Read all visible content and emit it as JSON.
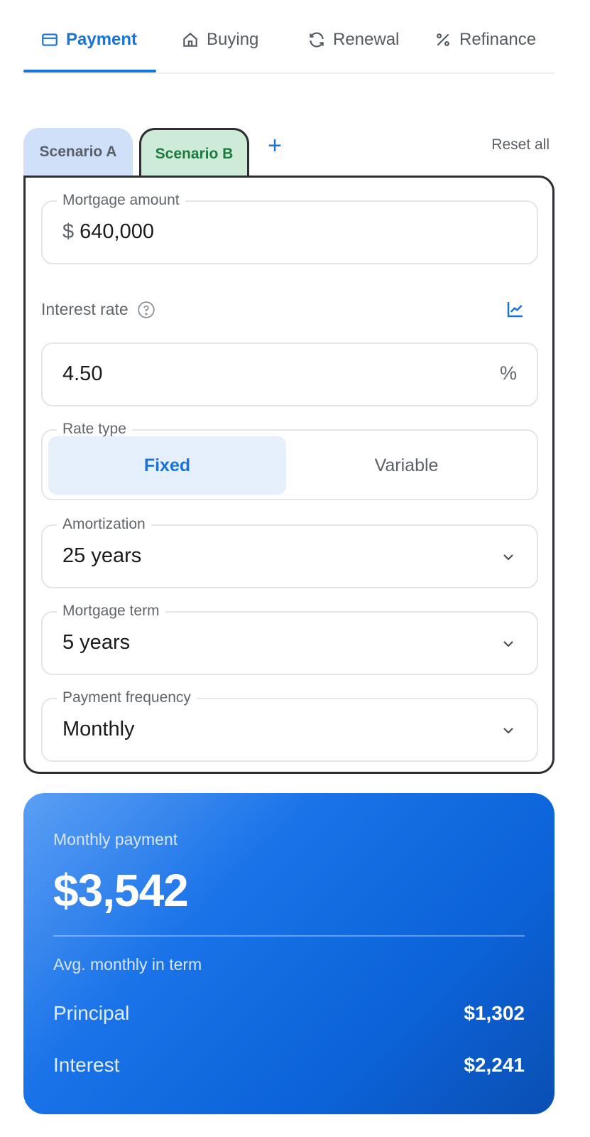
{
  "nav": {
    "tabs": [
      {
        "label": "Payment",
        "icon": "card-icon",
        "active": true
      },
      {
        "label": "Buying",
        "icon": "home-icon"
      },
      {
        "label": "Renewal",
        "icon": "refresh-icon"
      },
      {
        "label": "Refinance",
        "icon": "percent-icon"
      }
    ],
    "accent": "#1a73d8"
  },
  "scenarios": {
    "tabs": [
      {
        "label": "Scenario A",
        "color": "#cfe0f8"
      },
      {
        "label": "Scenario B",
        "color": "#cdebd6",
        "active": true
      }
    ],
    "add_label": "+",
    "reset_label": "Reset all"
  },
  "form": {
    "mortgage_amount": {
      "label": "Mortgage amount",
      "currency": "$",
      "value": "640,000"
    },
    "interest_rate": {
      "label": "Interest rate",
      "value": "4.50",
      "unit": "%"
    },
    "rate_type": {
      "label": "Rate type",
      "options": [
        "Fixed",
        "Variable"
      ],
      "selected": "Fixed"
    },
    "amortization": {
      "label": "Amortization",
      "value": "25 years"
    },
    "mortgage_term": {
      "label": "Mortgage term",
      "value": "5 years"
    },
    "payment_frequency": {
      "label": "Payment frequency",
      "value": "Monthly"
    }
  },
  "result": {
    "label": "Monthly payment",
    "amount": "$3,542",
    "sub_label": "Avg. monthly in term",
    "rows": [
      {
        "label": "Principal",
        "value": "$1,302"
      },
      {
        "label": "Interest",
        "value": "$2,241"
      }
    ]
  }
}
